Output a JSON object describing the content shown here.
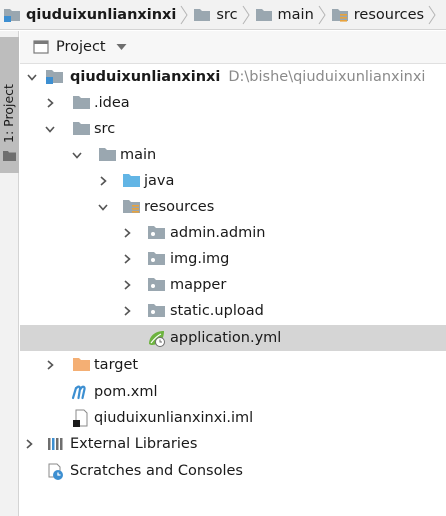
{
  "breadcrumb": [
    {
      "label": "qiuduixunlianxinxi",
      "icon": "project-folder-icon"
    },
    {
      "label": "src",
      "icon": "folder-icon"
    },
    {
      "label": "main",
      "icon": "folder-icon"
    },
    {
      "label": "resources",
      "icon": "resources-folder-icon"
    }
  ],
  "side_tab": {
    "label": "1: Project"
  },
  "panel": {
    "title": "Project"
  },
  "tree": {
    "root": {
      "label": "qiuduixunlianxinxi",
      "path": "D:\\bishe\\qiuduixunlianxinxi"
    },
    "idea": {
      "label": ".idea"
    },
    "src": {
      "label": "src"
    },
    "main": {
      "label": "main"
    },
    "java": {
      "label": "java"
    },
    "resources": {
      "label": "resources"
    },
    "admin_admin": {
      "label": "admin.admin"
    },
    "img_img": {
      "label": "img.img"
    },
    "mapper": {
      "label": "mapper"
    },
    "static_upload": {
      "label": "static.upload"
    },
    "application_yml": {
      "label": "application.yml"
    },
    "target": {
      "label": "target"
    },
    "pom_xml": {
      "label": "pom.xml"
    },
    "iml": {
      "label": "qiuduixunlianxinxi.iml"
    },
    "external_libraries": {
      "label": "External Libraries"
    },
    "scratches": {
      "label": "Scratches and Consoles"
    }
  },
  "colors": {
    "folder": "#9aa7b0",
    "java_folder": "#62b5e5",
    "target_folder": "#f4af74",
    "maven": "#3d8fd1",
    "spring": "#6db33f",
    "selection": "#d5d5d5"
  }
}
